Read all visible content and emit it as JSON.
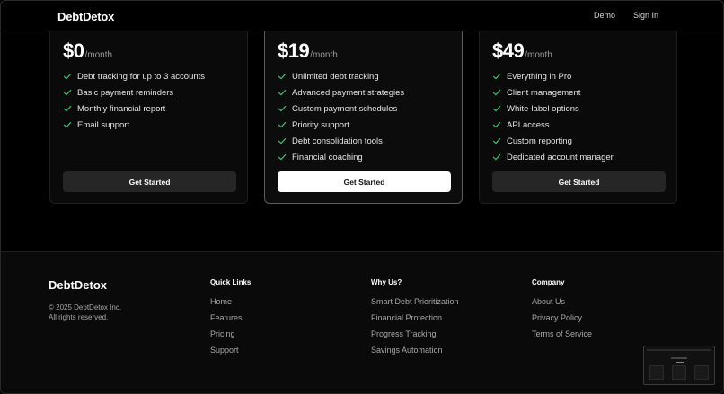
{
  "header": {
    "logo": "DebtDetox",
    "nav": [
      "Demo",
      "Sign In"
    ]
  },
  "plans": [
    {
      "amount": "$0",
      "period": "/month",
      "features": [
        "Debt tracking for up to 3 accounts",
        "Basic payment reminders",
        "Monthly financial report",
        "Email support"
      ],
      "cta": "Get Started"
    },
    {
      "amount": "$19",
      "period": "/month",
      "features": [
        "Unlimited debt tracking",
        "Advanced payment strategies",
        "Custom payment schedules",
        "Priority support",
        "Debt consolidation tools",
        "Financial coaching"
      ],
      "cta": "Get Started"
    },
    {
      "amount": "$49",
      "period": "/month",
      "features": [
        "Everything in Pro",
        "Client management",
        "White-label options",
        "API access",
        "Custom reporting",
        "Dedicated account manager"
      ],
      "cta": "Get Started"
    }
  ],
  "footer": {
    "logo": "DebtDetox",
    "copyright": "© 2025 DebtDetox Inc.",
    "rights": "All rights reserved.",
    "columns": [
      {
        "title": "Quick Links",
        "links": [
          "Home",
          "Features",
          "Pricing",
          "Support"
        ]
      },
      {
        "title": "Why Us?",
        "links": [
          "Smart Debt Prioritization",
          "Financial Protection",
          "Progress Tracking",
          "Savings Automation"
        ]
      },
      {
        "title": "Company",
        "links": [
          "About Us",
          "Privacy Policy",
          "Terms of Service"
        ]
      }
    ]
  },
  "colors": {
    "background": "#000000",
    "accent_check": "#3fb56b",
    "card_border_highlight": "#5c5c5c"
  },
  "icons": {
    "feature_bullet": "check-icon"
  }
}
